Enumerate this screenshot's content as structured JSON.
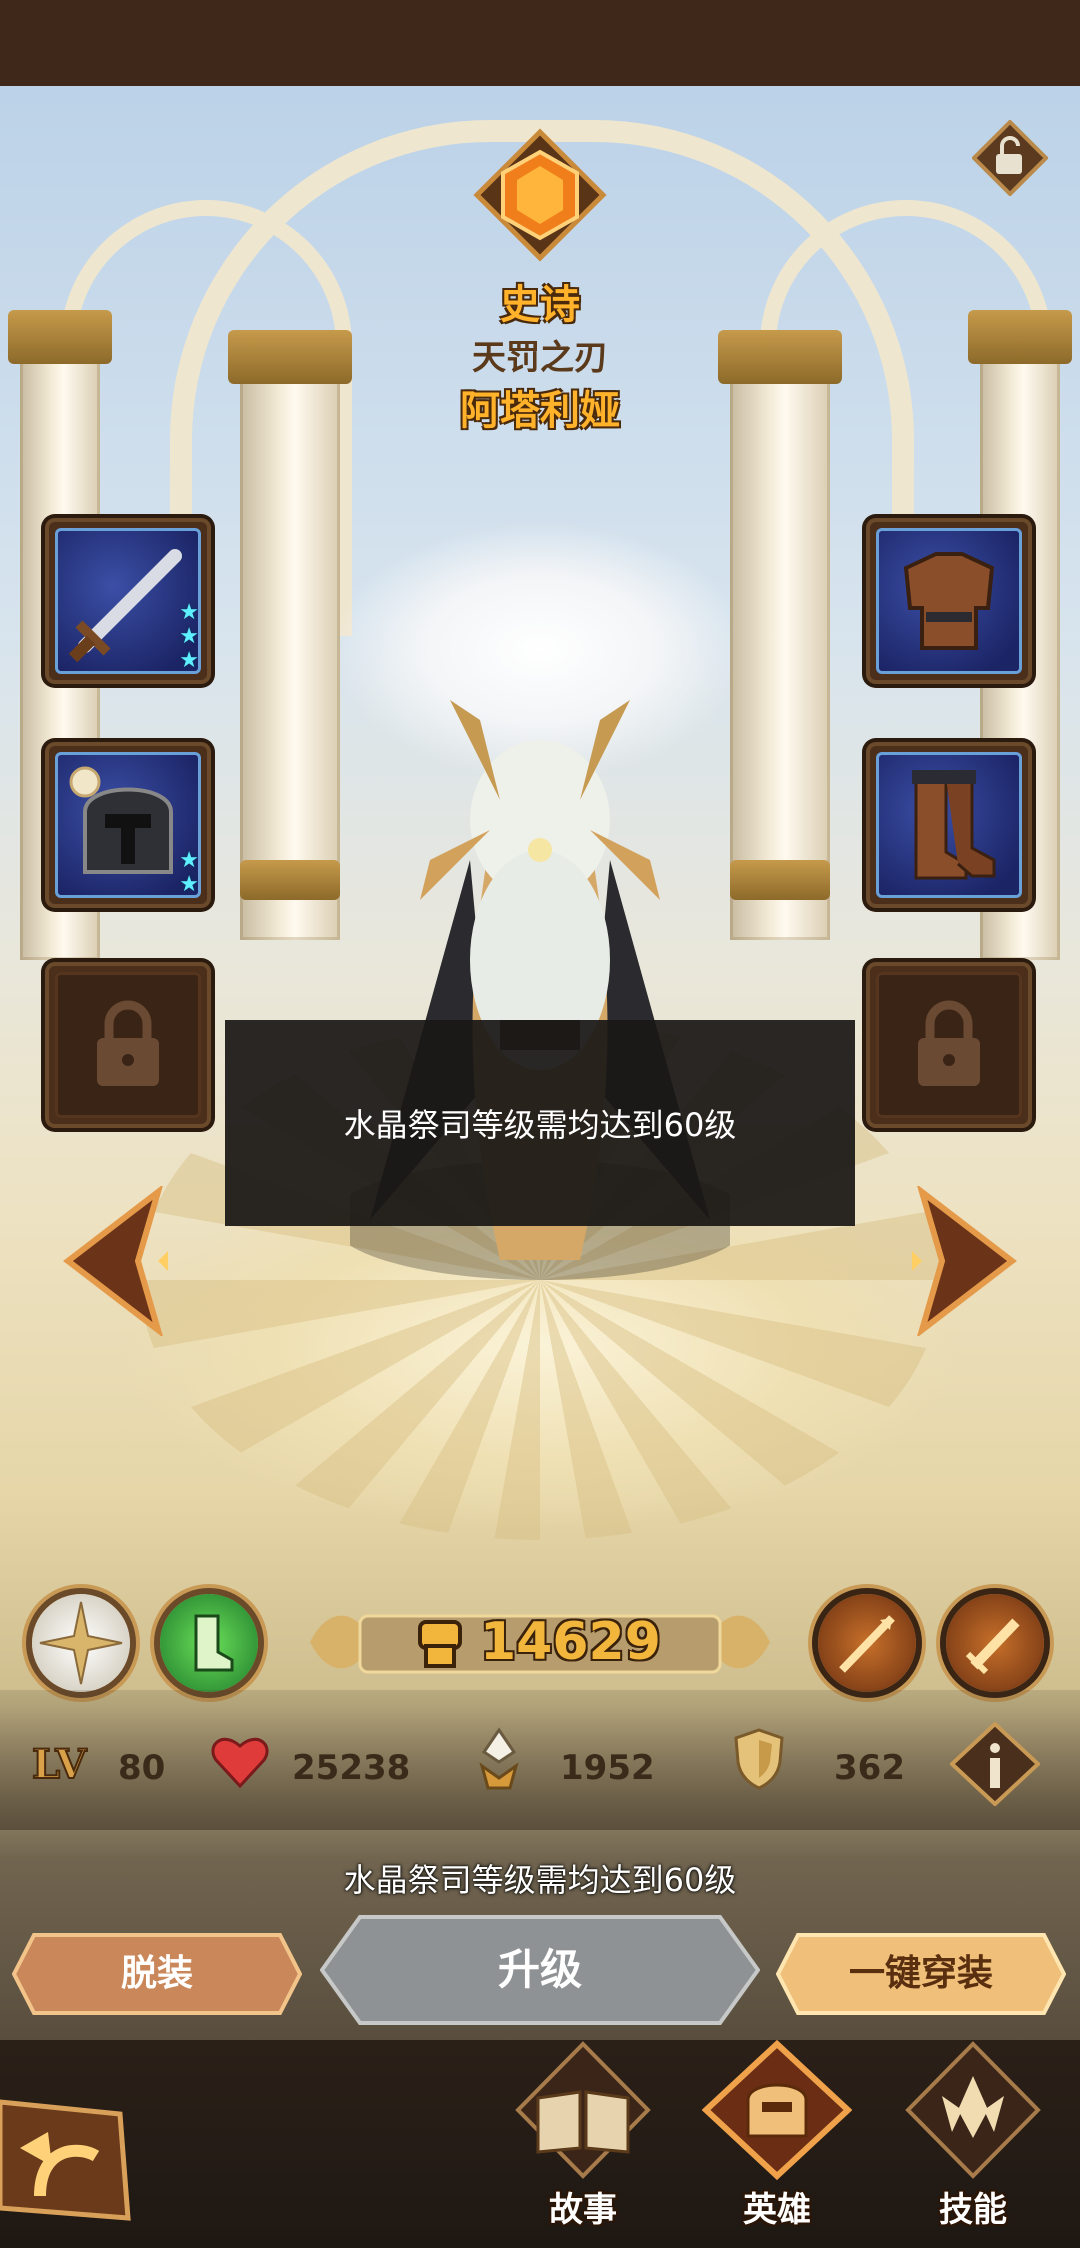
{
  "header": {
    "rarity": "史诗",
    "hero_title": "天罚之刃",
    "hero_name": "阿塔利娅"
  },
  "equipment": {
    "left": [
      {
        "name": "sword",
        "stars": 3,
        "locked": false
      },
      {
        "name": "helmet",
        "stars": 2,
        "locked": false
      },
      {
        "name": "locked-slot",
        "stars": 0,
        "locked": true
      }
    ],
    "right": [
      {
        "name": "armor",
        "stars": 0,
        "locked": false
      },
      {
        "name": "boots",
        "stars": 0,
        "locked": false
      },
      {
        "name": "locked-slot",
        "stars": 0,
        "locked": true
      }
    ]
  },
  "toast": {
    "message": "水晶祭司等级需均达到60级"
  },
  "power": {
    "value": "14629"
  },
  "stats": {
    "level": "80",
    "hp": "25238",
    "attack": "1952",
    "defense": "362"
  },
  "requirement_text": "水晶祭司等级需均达到60级",
  "buttons": {
    "unequip": "脱装",
    "upgrade": "升级",
    "equip_all": "一键穿装"
  },
  "nav": {
    "story": "故事",
    "hero": "英雄",
    "skill": "技能"
  },
  "icons": {
    "lock": "lock-icon",
    "back": "back-arrow-icon",
    "prev": "chevron-left-icon",
    "next": "chevron-right-icon",
    "info": "info-icon"
  },
  "colors": {
    "rarity_gold": "#ffb22a",
    "power_gold": "#f2b63c",
    "slot_blue": "#3b4fa6",
    "button_orange": "#d89a5c"
  }
}
